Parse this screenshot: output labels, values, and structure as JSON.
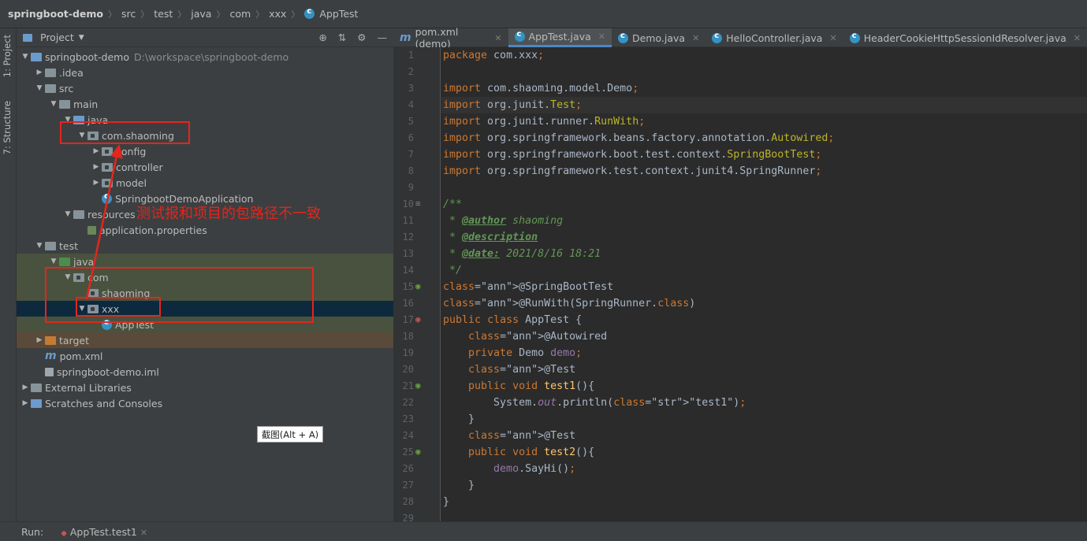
{
  "breadcrumb": [
    "springboot-demo",
    "src",
    "test",
    "java",
    "com",
    "xxx",
    "AppTest"
  ],
  "side_tabs": {
    "project": "1: Project",
    "structure": "7: Structure"
  },
  "project_panel": {
    "title": "Project"
  },
  "tree": [
    {
      "label": "springboot-demo",
      "extra": "D:\\workspace\\springboot-demo",
      "icon": "module-folder-icon"
    },
    {
      "label": ".idea",
      "icon": "folder-icon"
    },
    {
      "label": "src",
      "icon": "folder-icon"
    },
    {
      "label": "main",
      "icon": "folder-icon"
    },
    {
      "label": "java",
      "icon": "source-folder-icon"
    },
    {
      "label": "com.shaoming",
      "icon": "package-icon"
    },
    {
      "label": "config",
      "icon": "package-icon"
    },
    {
      "label": "controller",
      "icon": "package-icon"
    },
    {
      "label": "model",
      "icon": "package-icon"
    },
    {
      "label": "SpringbootDemoApplication",
      "icon": "class-icon"
    },
    {
      "label": "resources",
      "icon": "resources-folder-icon"
    },
    {
      "label": "application.properties",
      "icon": "properties-file-icon"
    },
    {
      "label": "test",
      "icon": "folder-icon"
    },
    {
      "label": "java",
      "icon": "test-source-folder-icon"
    },
    {
      "label": "com",
      "icon": "package-icon"
    },
    {
      "label": "shaoming",
      "icon": "package-icon"
    },
    {
      "label": "xxx",
      "icon": "package-icon"
    },
    {
      "label": "AppTest",
      "icon": "test-class-icon"
    },
    {
      "label": "target",
      "icon": "excluded-folder-icon"
    },
    {
      "label": "pom.xml",
      "icon": "maven-icon"
    },
    {
      "label": "springboot-demo.iml",
      "icon": "iml-file-icon"
    },
    {
      "label": "External Libraries",
      "icon": "libraries-icon"
    },
    {
      "label": "Scratches and Consoles",
      "icon": "scratches-icon"
    }
  ],
  "annotation_text": "测试报和项目的包路径不一致",
  "tooltip": "截图(Alt + A)",
  "editor_tabs": [
    {
      "label": "pom.xml (demo)",
      "icon": "maven-icon"
    },
    {
      "label": "AppTest.java",
      "icon": "class-icon"
    },
    {
      "label": "Demo.java",
      "icon": "class-icon"
    },
    {
      "label": "HelloController.java",
      "icon": "class-icon"
    },
    {
      "label": "HeaderCookieHttpSessionIdResolver.java",
      "icon": "class-icon"
    }
  ],
  "code_lines": [
    "package com.xxx;",
    "",
    "import com.shaoming.model.Demo;",
    "import org.junit.Test;",
    "import org.junit.runner.RunWith;",
    "import org.springframework.beans.factory.annotation.Autowired;",
    "import org.springframework.boot.test.context.SpringBootTest;",
    "import org.springframework.test.context.junit4.SpringRunner;",
    "",
    "/**",
    " * @author shaoming",
    " * @description",
    " * @date: 2021/8/16 18:21",
    " */",
    "@SpringBootTest",
    "@RunWith(SpringRunner.class)",
    "public class AppTest {",
    "    @Autowired",
    "    private Demo demo;",
    "    @Test",
    "    public void test1(){",
    "        System.out.println(\"test1\");",
    "    }",
    "    @Test",
    "    public void test2(){",
    "        demo.SayHi();",
    "    }",
    "}",
    ""
  ],
  "run_bar": {
    "label": "Run:",
    "config": "AppTest.test1"
  },
  "colors": {
    "keyword": "#cc7832",
    "annotation": "#bbb529",
    "comment": "#629755",
    "string": "#6a8759",
    "field": "#9876aa",
    "highlight_red": "#e5251c"
  }
}
